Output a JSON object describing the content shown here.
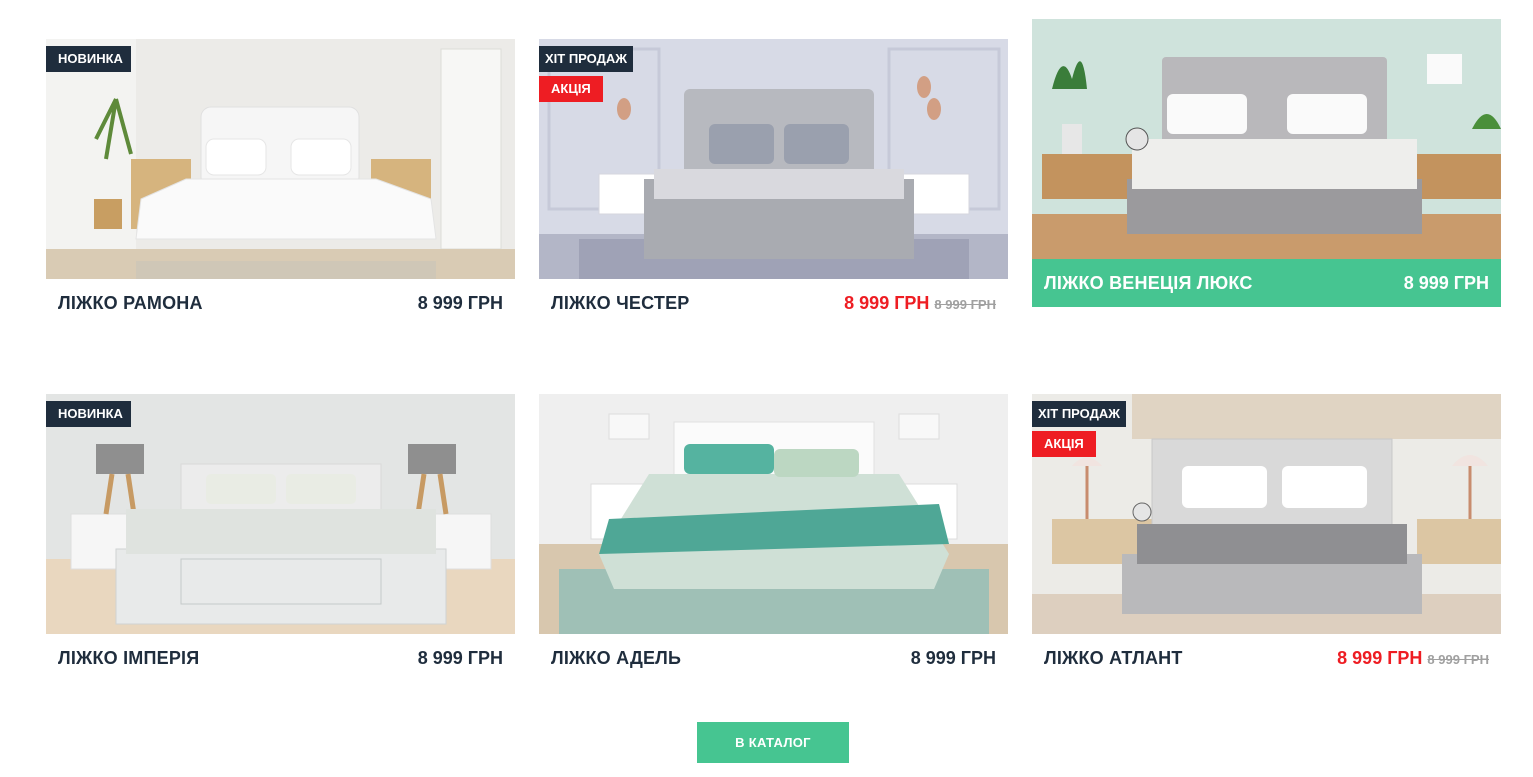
{
  "products": [
    {
      "name": "ЛІЖКО РАМОНА",
      "price": "8 999 ГРН",
      "old_price": "",
      "badges": [
        "НОВИНКА"
      ]
    },
    {
      "name": "ЛІЖКО ЧЕСТЕР",
      "price": "8 999 ГРН",
      "old_price": "8 999 ГРН",
      "badges": [
        "ХІТ ПРОДАЖ",
        "АКЦІЯ"
      ]
    },
    {
      "name": "ЛІЖКО ВЕНЕЦІЯ ЛЮКС",
      "price": "8 999 ГРН",
      "old_price": "",
      "badges": []
    },
    {
      "name": "ЛІЖКО ІМПЕРІЯ",
      "price": "8 999 ГРН",
      "old_price": "",
      "badges": [
        "НОВИНКА"
      ]
    },
    {
      "name": "ЛІЖКО АДЕЛЬ",
      "price": "8 999 ГРН",
      "old_price": "",
      "badges": []
    },
    {
      "name": "ЛІЖКО АТЛАНТ",
      "price": "8 999 ГРН",
      "old_price": "8 999 ГРН",
      "badges": [
        "ХІТ ПРОДАЖ",
        "АКЦІЯ"
      ]
    }
  ],
  "catalog_button": "В КАТАЛОГ",
  "colors": {
    "accent": "#46c591",
    "sale": "#ee1d23",
    "dark": "#1f2d3d",
    "old_price": "#a0a0a0"
  }
}
